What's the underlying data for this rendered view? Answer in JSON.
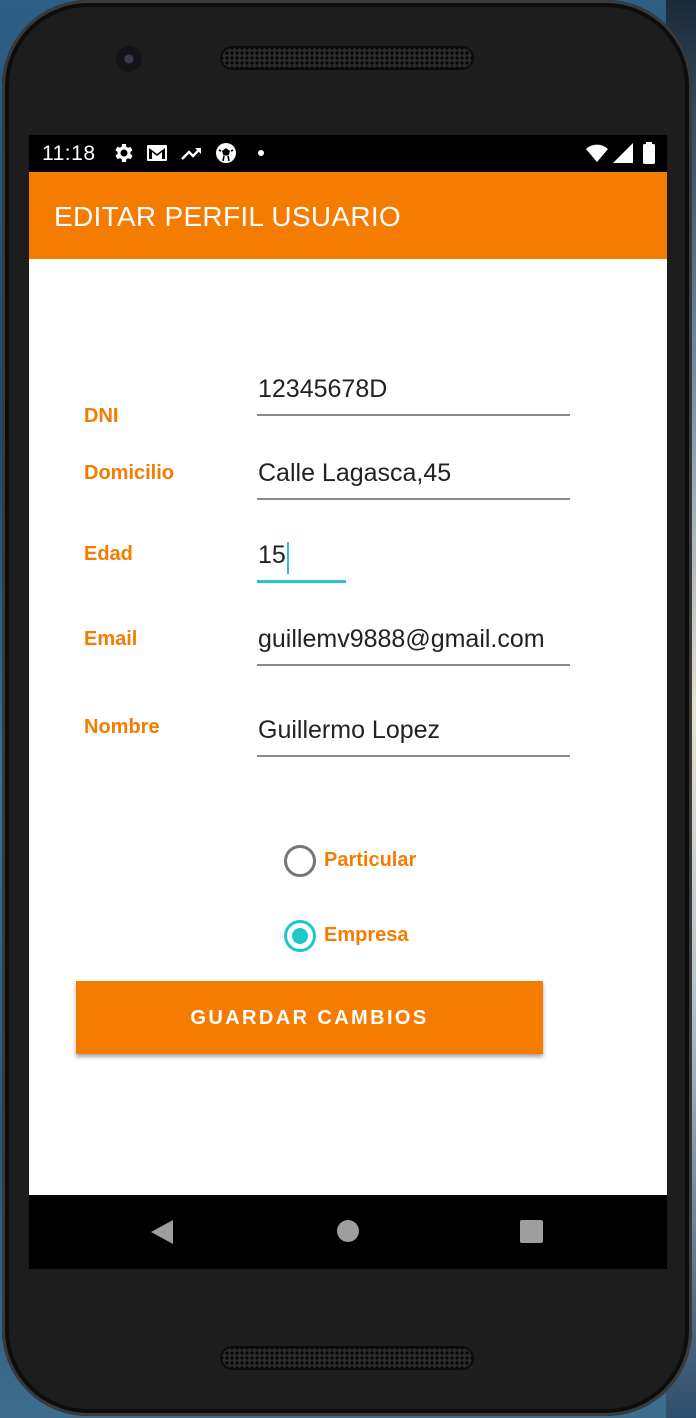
{
  "status_bar": {
    "time": "11:18",
    "left_icons": [
      "gear-icon",
      "gmail-icon",
      "trending-icon",
      "soccer-ball-icon",
      "dot-icon"
    ],
    "right_icons": [
      "wifi-icon",
      "signal-icon",
      "battery-icon"
    ]
  },
  "app_bar": {
    "title": "EDITAR PERFIL USUARIO"
  },
  "form": {
    "dni": {
      "label": "DNI",
      "value": "12345678D"
    },
    "domicilio": {
      "label": "Domicilio",
      "value": "Calle Lagasca,45"
    },
    "edad": {
      "label": "Edad",
      "value": "15"
    },
    "email": {
      "label": "Email",
      "value": "guillemv9888@gmail.com"
    },
    "nombre": {
      "label": "Nombre",
      "value": "Guillermo Lopez"
    }
  },
  "account_type": {
    "options": [
      {
        "label": "Particular",
        "checked": false
      },
      {
        "label": "Empresa",
        "checked": true
      }
    ]
  },
  "save_button": {
    "label": "GUARDAR CAMBIOS"
  },
  "nav_bar": {
    "icons": [
      "back-icon",
      "home-icon",
      "recents-icon"
    ]
  },
  "colors": {
    "accent": "#f57c00",
    "focus": "#26c6c6"
  }
}
